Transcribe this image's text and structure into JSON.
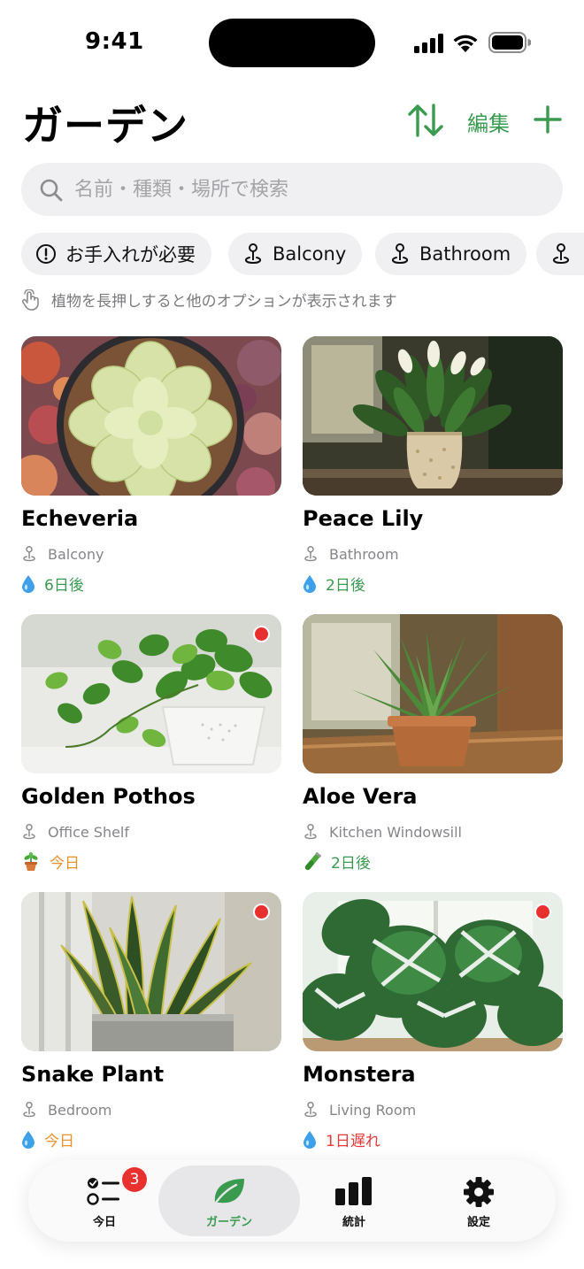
{
  "status_bar": {
    "time": "9:41"
  },
  "header": {
    "title": "ガーデン",
    "edit_label": "編集"
  },
  "search": {
    "placeholder": "名前・種類・場所で検索"
  },
  "chips": [
    {
      "label": "お手入れが必要",
      "icon": "exclamation-circle-icon"
    },
    {
      "label": "Balcony",
      "icon": "location-pin-icon"
    },
    {
      "label": "Bathroom",
      "icon": "location-pin-icon"
    }
  ],
  "hint": "植物を長押しすると他のオプションが表示されます",
  "plants": [
    {
      "name": "Echeveria",
      "location": "Balcony",
      "task_icon": "water-drop-icon",
      "task": "6日後",
      "task_color": "#3a9a4f",
      "needs_attention": false
    },
    {
      "name": "Peace Lily",
      "location": "Bathroom",
      "task_icon": "water-drop-icon",
      "task": "2日後",
      "task_color": "#3a9a4f",
      "needs_attention": false
    },
    {
      "name": "Golden Pothos",
      "location": "Office Shelf",
      "task_icon": "repot-plant-icon",
      "task": "今日",
      "task_color": "#e8922a",
      "needs_attention": true
    },
    {
      "name": "Aloe Vera",
      "location": "Kitchen Windowsill",
      "task_icon": "fertilizer-tube-icon",
      "task": "2日後",
      "task_color": "#3a9a4f",
      "needs_attention": false
    },
    {
      "name": "Snake Plant",
      "location": "Bedroom",
      "task_icon": "water-drop-icon",
      "task": "今日",
      "task_color": "#e8922a",
      "needs_attention": true
    },
    {
      "name": "Monstera",
      "location": "Living Room",
      "task_icon": "water-drop-icon",
      "task": "1日遅れ",
      "task_color": "#e5393a",
      "needs_attention": true
    }
  ],
  "tabbar": {
    "items": [
      {
        "label": "今日",
        "icon": "checklist-icon",
        "badge": "3",
        "active": false
      },
      {
        "label": "ガーデン",
        "icon": "leaf-icon",
        "active": true
      },
      {
        "label": "統計",
        "icon": "bar-chart-icon",
        "active": false
      },
      {
        "label": "設定",
        "icon": "gear-icon",
        "active": false
      }
    ]
  },
  "colors": {
    "accent": "#3a9a4f",
    "due_today": "#e8922a",
    "overdue": "#e5393a",
    "badge": "#e8302f"
  }
}
